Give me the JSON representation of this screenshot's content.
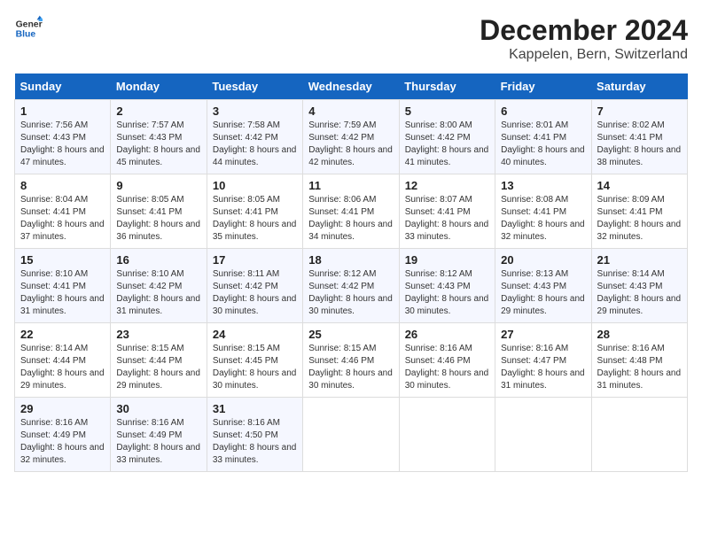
{
  "header": {
    "logo_line1": "General",
    "logo_line2": "Blue",
    "title": "December 2024",
    "subtitle": "Kappelen, Bern, Switzerland"
  },
  "weekdays": [
    "Sunday",
    "Monday",
    "Tuesday",
    "Wednesday",
    "Thursday",
    "Friday",
    "Saturday"
  ],
  "weeks": [
    [
      {
        "day": "1",
        "sunrise": "Sunrise: 7:56 AM",
        "sunset": "Sunset: 4:43 PM",
        "daylight": "Daylight: 8 hours and 47 minutes."
      },
      {
        "day": "2",
        "sunrise": "Sunrise: 7:57 AM",
        "sunset": "Sunset: 4:43 PM",
        "daylight": "Daylight: 8 hours and 45 minutes."
      },
      {
        "day": "3",
        "sunrise": "Sunrise: 7:58 AM",
        "sunset": "Sunset: 4:42 PM",
        "daylight": "Daylight: 8 hours and 44 minutes."
      },
      {
        "day": "4",
        "sunrise": "Sunrise: 7:59 AM",
        "sunset": "Sunset: 4:42 PM",
        "daylight": "Daylight: 8 hours and 42 minutes."
      },
      {
        "day": "5",
        "sunrise": "Sunrise: 8:00 AM",
        "sunset": "Sunset: 4:42 PM",
        "daylight": "Daylight: 8 hours and 41 minutes."
      },
      {
        "day": "6",
        "sunrise": "Sunrise: 8:01 AM",
        "sunset": "Sunset: 4:41 PM",
        "daylight": "Daylight: 8 hours and 40 minutes."
      },
      {
        "day": "7",
        "sunrise": "Sunrise: 8:02 AM",
        "sunset": "Sunset: 4:41 PM",
        "daylight": "Daylight: 8 hours and 38 minutes."
      }
    ],
    [
      {
        "day": "8",
        "sunrise": "Sunrise: 8:04 AM",
        "sunset": "Sunset: 4:41 PM",
        "daylight": "Daylight: 8 hours and 37 minutes."
      },
      {
        "day": "9",
        "sunrise": "Sunrise: 8:05 AM",
        "sunset": "Sunset: 4:41 PM",
        "daylight": "Daylight: 8 hours and 36 minutes."
      },
      {
        "day": "10",
        "sunrise": "Sunrise: 8:05 AM",
        "sunset": "Sunset: 4:41 PM",
        "daylight": "Daylight: 8 hours and 35 minutes."
      },
      {
        "day": "11",
        "sunrise": "Sunrise: 8:06 AM",
        "sunset": "Sunset: 4:41 PM",
        "daylight": "Daylight: 8 hours and 34 minutes."
      },
      {
        "day": "12",
        "sunrise": "Sunrise: 8:07 AM",
        "sunset": "Sunset: 4:41 PM",
        "daylight": "Daylight: 8 hours and 33 minutes."
      },
      {
        "day": "13",
        "sunrise": "Sunrise: 8:08 AM",
        "sunset": "Sunset: 4:41 PM",
        "daylight": "Daylight: 8 hours and 32 minutes."
      },
      {
        "day": "14",
        "sunrise": "Sunrise: 8:09 AM",
        "sunset": "Sunset: 4:41 PM",
        "daylight": "Daylight: 8 hours and 32 minutes."
      }
    ],
    [
      {
        "day": "15",
        "sunrise": "Sunrise: 8:10 AM",
        "sunset": "Sunset: 4:41 PM",
        "daylight": "Daylight: 8 hours and 31 minutes."
      },
      {
        "day": "16",
        "sunrise": "Sunrise: 8:10 AM",
        "sunset": "Sunset: 4:42 PM",
        "daylight": "Daylight: 8 hours and 31 minutes."
      },
      {
        "day": "17",
        "sunrise": "Sunrise: 8:11 AM",
        "sunset": "Sunset: 4:42 PM",
        "daylight": "Daylight: 8 hours and 30 minutes."
      },
      {
        "day": "18",
        "sunrise": "Sunrise: 8:12 AM",
        "sunset": "Sunset: 4:42 PM",
        "daylight": "Daylight: 8 hours and 30 minutes."
      },
      {
        "day": "19",
        "sunrise": "Sunrise: 8:12 AM",
        "sunset": "Sunset: 4:43 PM",
        "daylight": "Daylight: 8 hours and 30 minutes."
      },
      {
        "day": "20",
        "sunrise": "Sunrise: 8:13 AM",
        "sunset": "Sunset: 4:43 PM",
        "daylight": "Daylight: 8 hours and 29 minutes."
      },
      {
        "day": "21",
        "sunrise": "Sunrise: 8:14 AM",
        "sunset": "Sunset: 4:43 PM",
        "daylight": "Daylight: 8 hours and 29 minutes."
      }
    ],
    [
      {
        "day": "22",
        "sunrise": "Sunrise: 8:14 AM",
        "sunset": "Sunset: 4:44 PM",
        "daylight": "Daylight: 8 hours and 29 minutes."
      },
      {
        "day": "23",
        "sunrise": "Sunrise: 8:15 AM",
        "sunset": "Sunset: 4:44 PM",
        "daylight": "Daylight: 8 hours and 29 minutes."
      },
      {
        "day": "24",
        "sunrise": "Sunrise: 8:15 AM",
        "sunset": "Sunset: 4:45 PM",
        "daylight": "Daylight: 8 hours and 30 minutes."
      },
      {
        "day": "25",
        "sunrise": "Sunrise: 8:15 AM",
        "sunset": "Sunset: 4:46 PM",
        "daylight": "Daylight: 8 hours and 30 minutes."
      },
      {
        "day": "26",
        "sunrise": "Sunrise: 8:16 AM",
        "sunset": "Sunset: 4:46 PM",
        "daylight": "Daylight: 8 hours and 30 minutes."
      },
      {
        "day": "27",
        "sunrise": "Sunrise: 8:16 AM",
        "sunset": "Sunset: 4:47 PM",
        "daylight": "Daylight: 8 hours and 31 minutes."
      },
      {
        "day": "28",
        "sunrise": "Sunrise: 8:16 AM",
        "sunset": "Sunset: 4:48 PM",
        "daylight": "Daylight: 8 hours and 31 minutes."
      }
    ],
    [
      {
        "day": "29",
        "sunrise": "Sunrise: 8:16 AM",
        "sunset": "Sunset: 4:49 PM",
        "daylight": "Daylight: 8 hours and 32 minutes."
      },
      {
        "day": "30",
        "sunrise": "Sunrise: 8:16 AM",
        "sunset": "Sunset: 4:49 PM",
        "daylight": "Daylight: 8 hours and 33 minutes."
      },
      {
        "day": "31",
        "sunrise": "Sunrise: 8:16 AM",
        "sunset": "Sunset: 4:50 PM",
        "daylight": "Daylight: 8 hours and 33 minutes."
      },
      null,
      null,
      null,
      null
    ]
  ]
}
